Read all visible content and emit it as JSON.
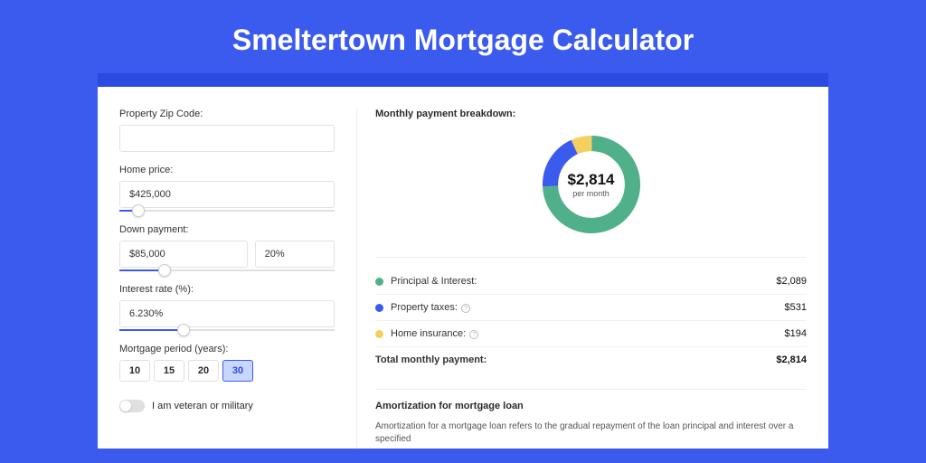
{
  "title": "Smeltertown Mortgage Calculator",
  "fields": {
    "zip": {
      "label": "Property Zip Code:",
      "value": ""
    },
    "home_price": {
      "label": "Home price:",
      "value": "$425,000",
      "slider_pct": 9
    },
    "down_payment": {
      "label": "Down payment:",
      "value": "$85,000",
      "pct_value": "20%",
      "slider_pct": 21
    },
    "interest": {
      "label": "Interest rate (%):",
      "value": "6.230%",
      "slider_pct": 30
    },
    "period": {
      "label": "Mortgage period (years):",
      "options": [
        "10",
        "15",
        "20",
        "30"
      ],
      "selected": "30"
    },
    "veteran": {
      "label": "I am veteran or military",
      "on": false
    }
  },
  "breakdown": {
    "title": "Monthly payment breakdown:",
    "center_value": "$2,814",
    "center_sub": "per month",
    "rows": [
      {
        "color": "#4fb08a",
        "label": "Principal & Interest:",
        "amount": "$2,089",
        "info": false
      },
      {
        "color": "#3b5bef",
        "label": "Property taxes:",
        "amount": "$531",
        "info": true
      },
      {
        "color": "#f3d060",
        "label": "Home insurance:",
        "amount": "$194",
        "info": true
      }
    ],
    "total_label": "Total monthly payment:",
    "total_amount": "$2,814"
  },
  "amort": {
    "title": "Amortization for mortgage loan",
    "text": "Amortization for a mortgage loan refers to the gradual repayment of the loan principal and interest over a specified"
  },
  "chart_data": {
    "type": "pie",
    "title": "Monthly payment breakdown",
    "series": [
      {
        "name": "Principal & Interest",
        "value": 2089,
        "color": "#4fb08a"
      },
      {
        "name": "Property taxes",
        "value": 531,
        "color": "#3b5bef"
      },
      {
        "name": "Home insurance",
        "value": 194,
        "color": "#f3d060"
      }
    ],
    "total": 2814,
    "donut_inner_label": "$2,814 per month"
  }
}
